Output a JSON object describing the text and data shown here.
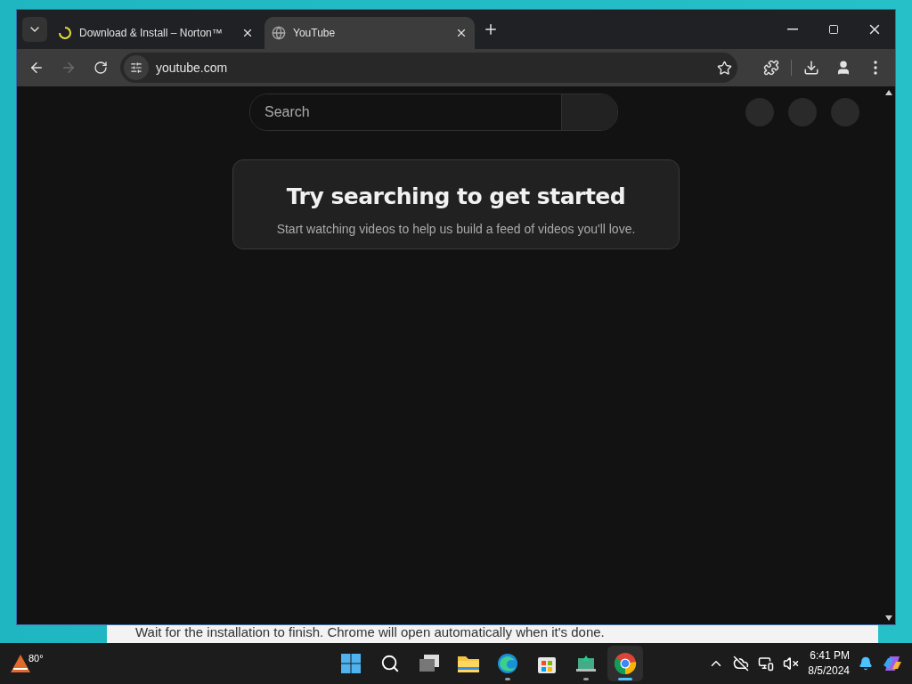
{
  "browser": {
    "tabs": [
      {
        "title": "Download & Install – Norton™",
        "selected": false,
        "loading": true
      },
      {
        "title": "YouTube",
        "selected": true,
        "loading": false
      }
    ],
    "address": "youtube.com"
  },
  "page": {
    "search": {
      "placeholder": "Search"
    },
    "empty_state": {
      "title": "Try searching to get started",
      "message": "Start watching videos to help us build a feed of videos you'll love."
    }
  },
  "background_page": {
    "text": "Wait for the installation to finish. Chrome will open automatically when it's done."
  },
  "taskbar": {
    "weather": "80°",
    "apps": [
      {
        "kind": "start",
        "running": false,
        "selected": false
      },
      {
        "kind": "search",
        "running": false,
        "selected": false
      },
      {
        "kind": "taskview",
        "running": false,
        "selected": false
      },
      {
        "kind": "files",
        "running": false,
        "selected": false
      },
      {
        "kind": "edge",
        "running": true,
        "selected": false
      },
      {
        "kind": "store",
        "running": false,
        "selected": false
      },
      {
        "kind": "app",
        "running": true,
        "selected": false
      },
      {
        "kind": "chrome",
        "running": true,
        "selected": true
      }
    ],
    "time": "6:41 PM",
    "date": "8/5/2024"
  }
}
